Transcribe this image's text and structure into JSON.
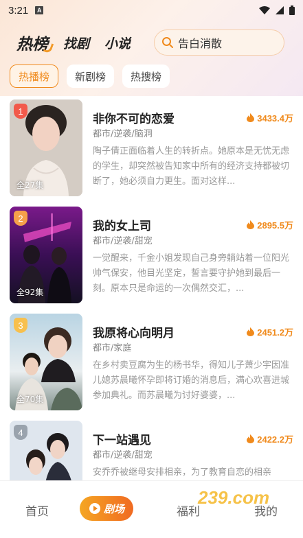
{
  "status_bar": {
    "time": "3:21",
    "notif_badge": "A"
  },
  "header": {
    "tabs": [
      {
        "label": "热榜"
      },
      {
        "label": "找剧"
      },
      {
        "label": "小说"
      }
    ],
    "search_placeholder": "告白消散"
  },
  "chips": [
    {
      "label": "热播榜"
    },
    {
      "label": "新剧榜"
    },
    {
      "label": "热搜榜"
    }
  ],
  "dramas": [
    {
      "rank": "1",
      "title": "非你不可的恋爱",
      "heat": "3433.4万",
      "tags": "都市/逆袭/脑洞",
      "desc": "陶子倩正面临着人生的转折点。她原本是无忧无虑的学生，却突然被告知家中所有的经济支持都被切断了，她必须自力更生。面对这样...",
      "episodes": "全27集"
    },
    {
      "rank": "2",
      "title": "我的女上司",
      "heat": "2895.5万",
      "tags": "都市/逆袭/甜宠",
      "desc": "一觉醒来，千金小姐发现自己身旁躺站着一位阳光帅气保安，他目光坚定，誓言要守护她到最后一刻。原本只是命运的一次偶然交汇，...",
      "episodes": "全92集"
    },
    {
      "rank": "3",
      "title": "我原将心向明月",
      "heat": "2451.2万",
      "tags": "都市/家庭",
      "desc": "在乡村卖豆腐为生的杨书华，得知儿子萧少宇因准儿媳苏晨曦怀孕即将订婚的消息后，满心欢喜进城参加典礼。而苏晨曦为讨好婆婆，...",
      "episodes": "全70集"
    },
    {
      "rank": "4",
      "title": "下一站遇见",
      "heat": "2422.2万",
      "tags": "都市/逆袭/甜宠",
      "desc": "安乔乔被继母安排相亲，为了教育自恋的相亲",
      "episodes": ""
    }
  ],
  "bottom_nav": {
    "home": "首页",
    "theater": "剧场",
    "welfare": "福利",
    "mine": "我的"
  },
  "watermark": {
    "text": "239.com"
  },
  "colors": {
    "accent": "#f08a1c",
    "rank1": "#f25a4b",
    "rank2": "#f5a04a",
    "rank3": "#f7c04e",
    "rank4": "#9aa3ad"
  }
}
